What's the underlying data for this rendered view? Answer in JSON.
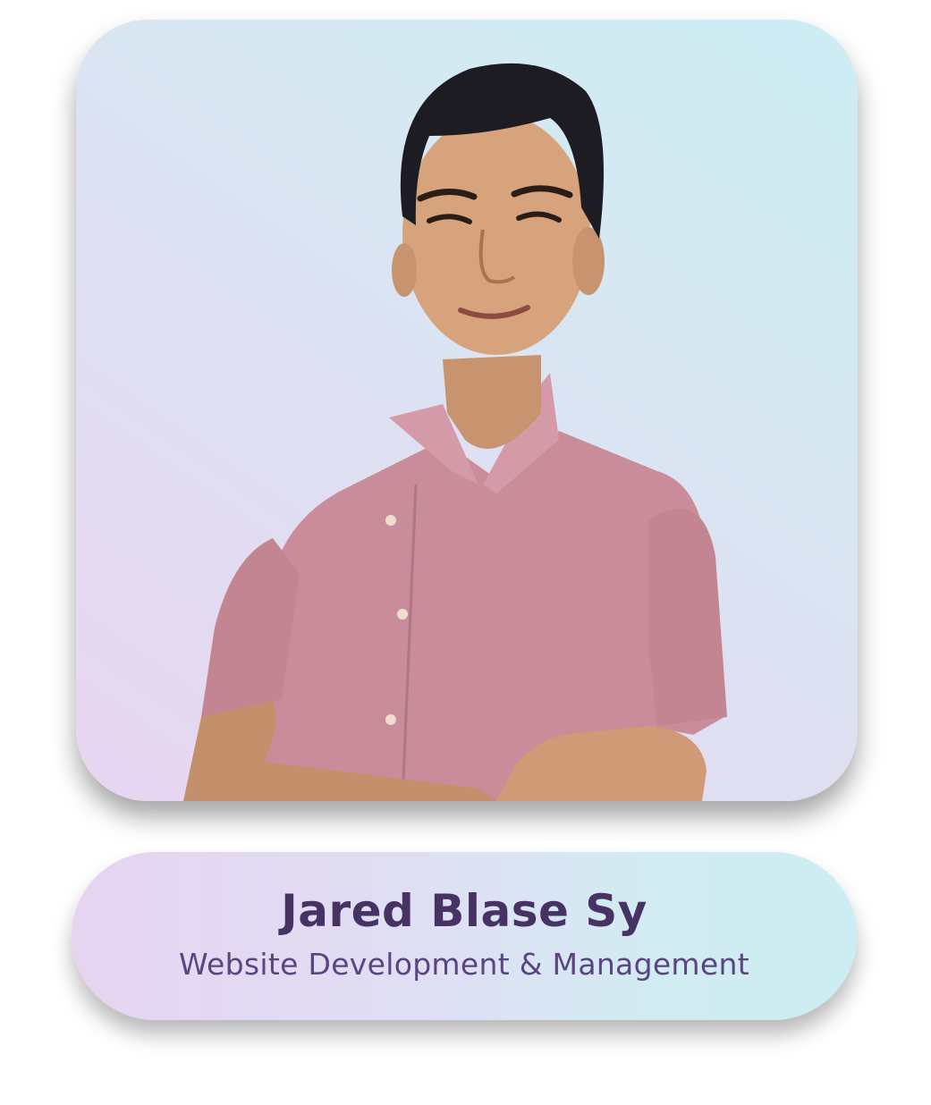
{
  "profile": {
    "name": "Jared Blase Sy",
    "role": "Website Development & Management"
  },
  "photo": {
    "icon": "person-portrait",
    "shirt_color": "#c98c9b",
    "background_from": "#e7d5f1",
    "background_to": "#ccedf3"
  },
  "colors": {
    "name_text": "#463364",
    "role_text": "#5a4580"
  }
}
